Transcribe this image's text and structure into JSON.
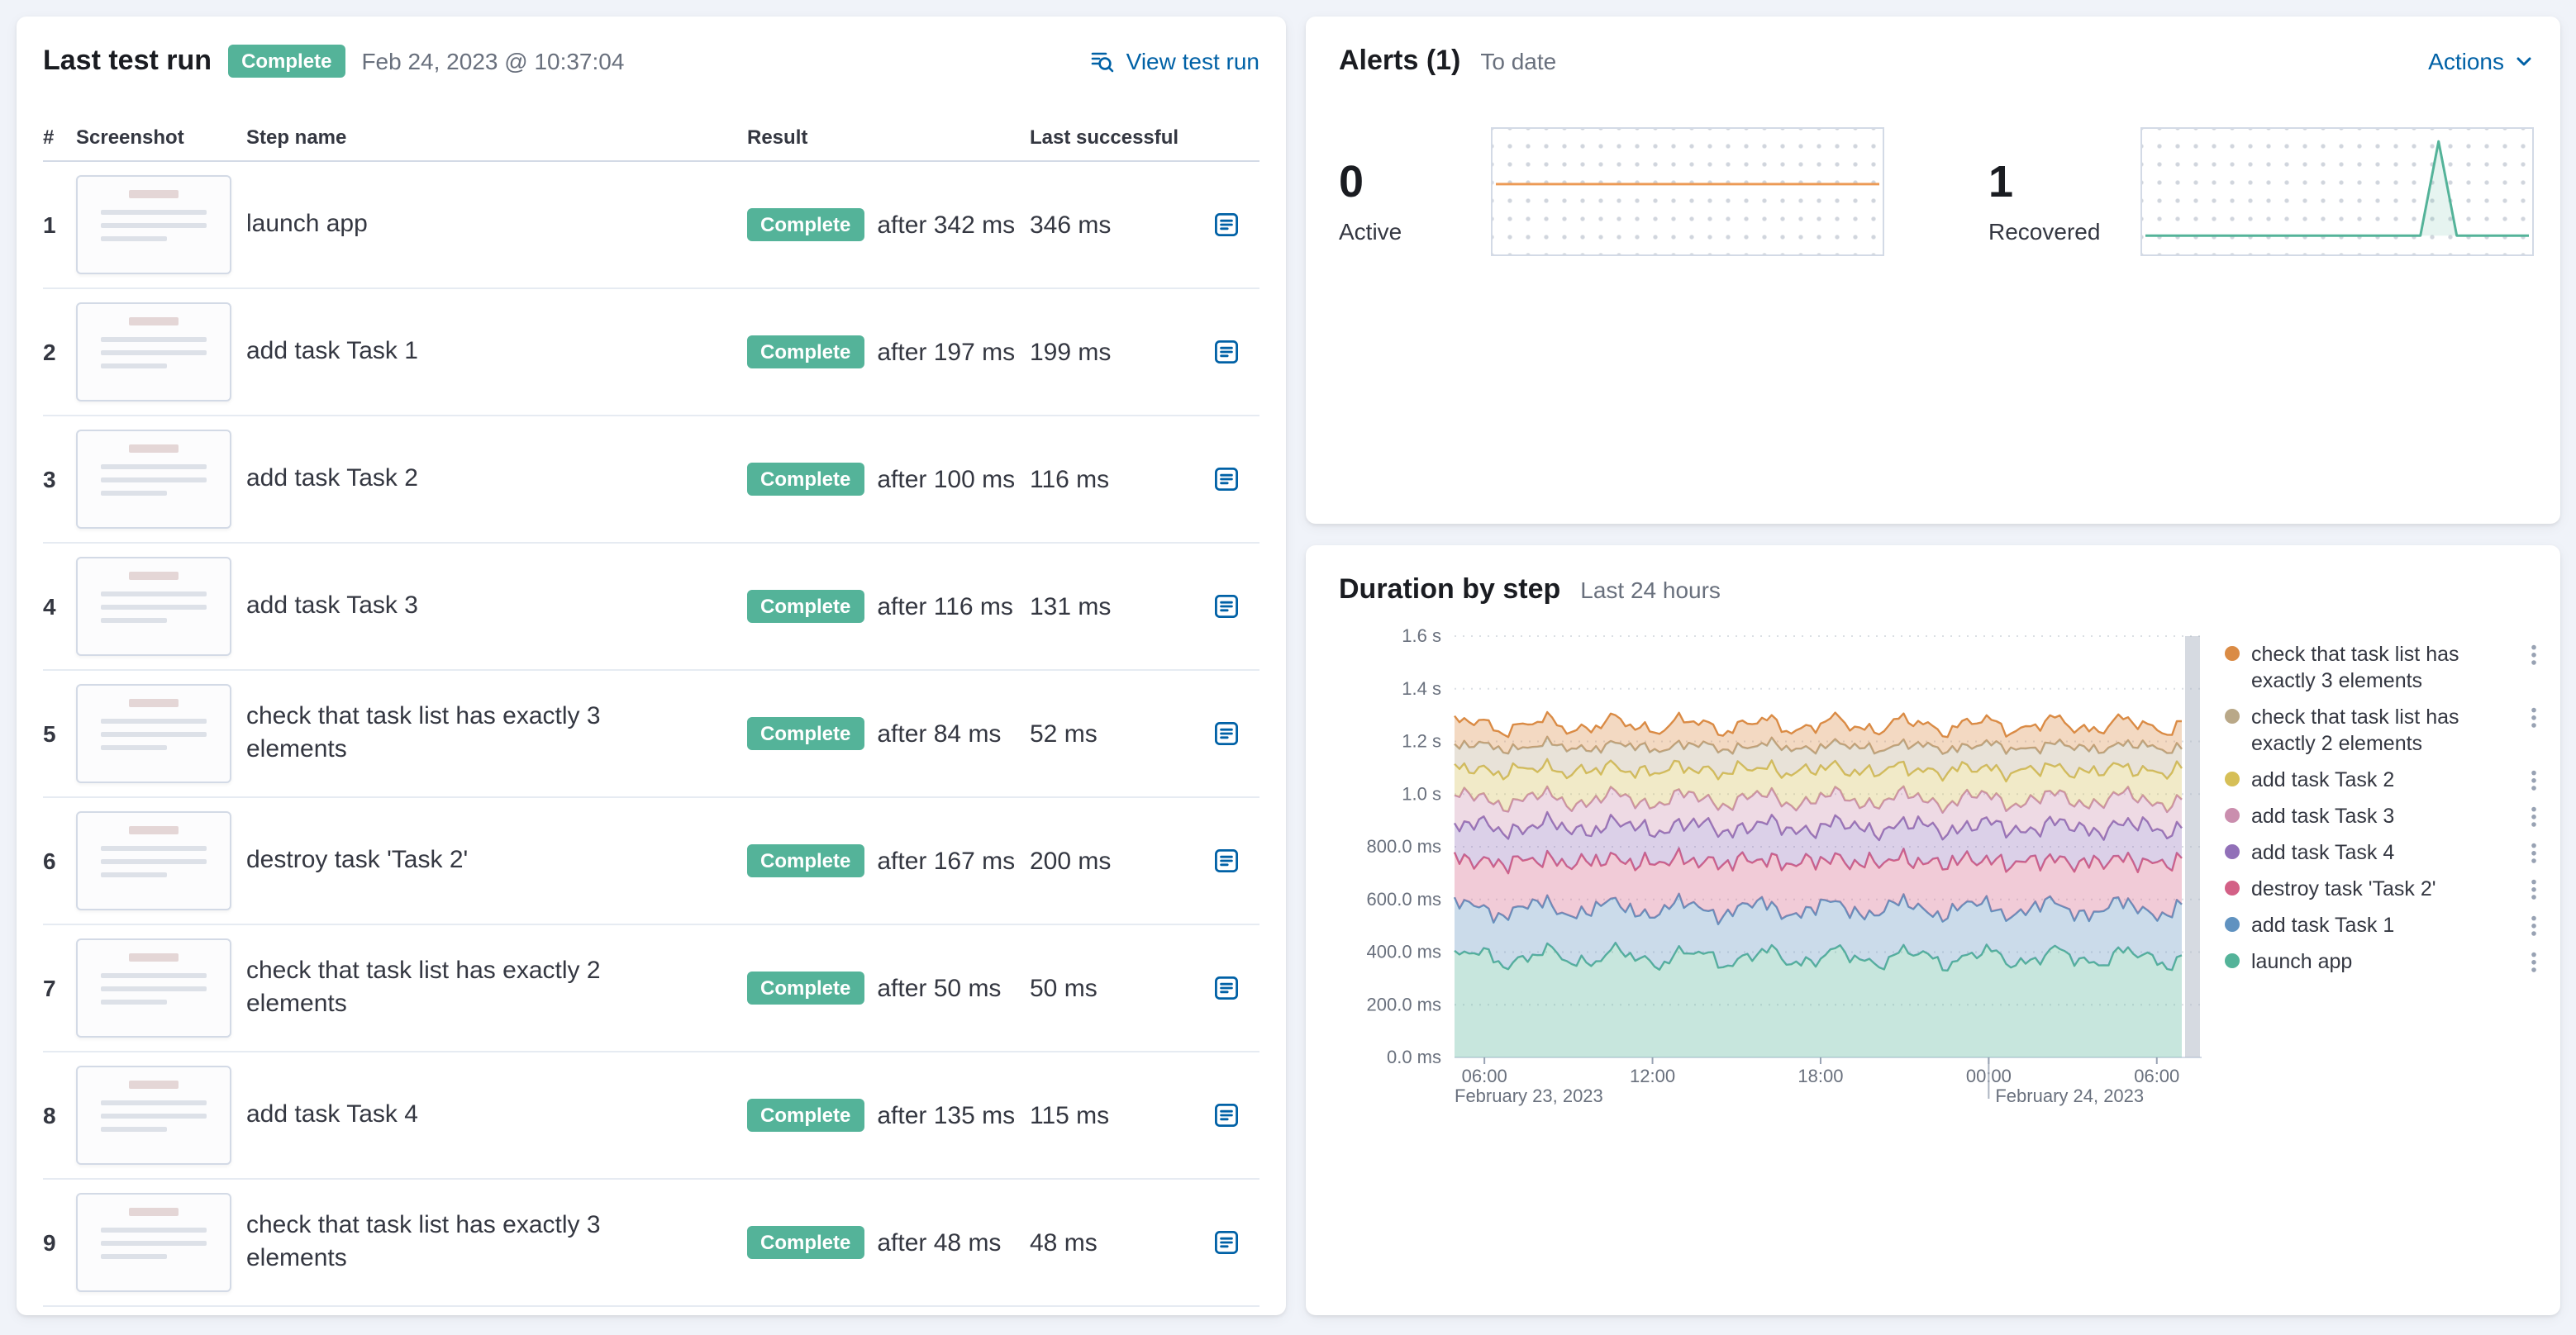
{
  "last_test_run": {
    "title": "Last test run",
    "status_badge": "Complete",
    "timestamp": "Feb 24, 2023 @ 10:37:04",
    "view_link": "View test run",
    "columns": {
      "num": "#",
      "screenshot": "Screenshot",
      "step": "Step name",
      "result": "Result",
      "last_successful": "Last successful"
    },
    "steps": [
      {
        "num": "1",
        "name": "launch app",
        "badge": "Complete",
        "after": "after 342 ms",
        "last": "346 ms"
      },
      {
        "num": "2",
        "name": "add task Task 1",
        "badge": "Complete",
        "after": "after 197 ms",
        "last": "199 ms"
      },
      {
        "num": "3",
        "name": "add task Task 2",
        "badge": "Complete",
        "after": "after 100 ms",
        "last": "116 ms"
      },
      {
        "num": "4",
        "name": "add task Task 3",
        "badge": "Complete",
        "after": "after 116 ms",
        "last": "131 ms"
      },
      {
        "num": "5",
        "name": "check that task list has exactly 3 elements",
        "badge": "Complete",
        "after": "after 84 ms",
        "last": "52 ms"
      },
      {
        "num": "6",
        "name": "destroy task 'Task 2'",
        "badge": "Complete",
        "after": "after 167 ms",
        "last": "200 ms"
      },
      {
        "num": "7",
        "name": "check that task list has exactly 2 elements",
        "badge": "Complete",
        "after": "after 50 ms",
        "last": "50 ms"
      },
      {
        "num": "8",
        "name": "add task Task 4",
        "badge": "Complete",
        "after": "after 135 ms",
        "last": "115 ms"
      },
      {
        "num": "9",
        "name": "check that task list has exactly 3 elements",
        "badge": "Complete",
        "after": "after 48 ms",
        "last": "48 ms"
      }
    ]
  },
  "alerts": {
    "title": "Alerts (1)",
    "subtitle": "To date",
    "actions_label": "Actions",
    "stats": [
      {
        "value": "0",
        "label": "Active",
        "color": "#EC9A55",
        "spark": {
          "type": "flat",
          "y_frac": 0.44
        }
      },
      {
        "value": "1",
        "label": "Recovered",
        "color": "#54B399",
        "spark": {
          "type": "spike",
          "base_frac": 0.85,
          "spike_x_frac": 0.76,
          "peak_y_frac": 0.1
        }
      }
    ]
  },
  "duration": {
    "title": "Duration by step",
    "subtitle": "Last 24 hours",
    "chart_data": {
      "type": "area",
      "stacked": true,
      "title": "Duration by step",
      "x_axis": {
        "ticks": [
          {
            "label": "06:00",
            "frac": 0.04
          },
          {
            "label": "12:00",
            "frac": 0.265
          },
          {
            "label": "18:00",
            "frac": 0.49
          },
          {
            "label": "00:00",
            "frac": 0.715
          },
          {
            "label": "06:00",
            "frac": 0.94
          }
        ],
        "date_labels": [
          {
            "text": "February 23, 2023",
            "frac": 0.0
          },
          {
            "text": "February 24, 2023",
            "frac": 0.715
          }
        ],
        "day_separator_frac": 0.715
      },
      "y_axis": {
        "ticks": [
          "0.0 ms",
          "200.0 ms",
          "400.0 ms",
          "600.0 ms",
          "800.0 ms",
          "1.0 s",
          "1.2 s",
          "1.4 s",
          "1.6 s"
        ],
        "max_ms": 1600
      },
      "series": [
        {
          "name": "launch app",
          "color": "#54B399",
          "avg_ms": 380,
          "wave_ms": 55
        },
        {
          "name": "add task Task 1",
          "color": "#6092C0",
          "avg_ms": 185,
          "wave_ms": 40
        },
        {
          "name": "destroy task 'Task 2'",
          "color": "#D36086",
          "avg_ms": 180,
          "wave_ms": 40
        },
        {
          "name": "add task Task 4",
          "color": "#9170B8",
          "avg_ms": 130,
          "wave_ms": 35
        },
        {
          "name": "add task Task 3",
          "color": "#CA8EAE",
          "avg_ms": 105,
          "wave_ms": 28
        },
        {
          "name": "add task Task 2",
          "color": "#D6BF57",
          "avg_ms": 112,
          "wave_ms": 32
        },
        {
          "name": "check that task list has exactly 2 elements",
          "color": "#B9A888",
          "avg_ms": 88,
          "wave_ms": 24
        },
        {
          "name": "check that task list has exactly 3 elements",
          "color": "#DA8B45",
          "avg_ms": 82,
          "wave_ms": 28
        }
      ],
      "legend_note": "legend displayed top-to-bottom is reverse of stacking order"
    }
  }
}
